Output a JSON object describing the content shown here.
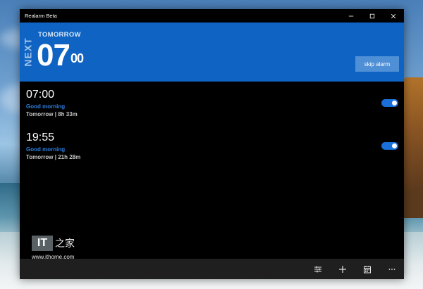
{
  "window": {
    "title": "Realarm Beta"
  },
  "banner": {
    "vertical_label": "NEXT",
    "label": "TOMORROW",
    "time_hour": "07",
    "time_minute": "00",
    "skip_label": "skip alarm"
  },
  "alarms": [
    {
      "time": "07:00",
      "name": "Good morning",
      "info": "Tomorrow | 8h 33m",
      "enabled": true
    },
    {
      "time": "19:55",
      "name": "Good morning",
      "info": "Tomorrow | 21h 28m",
      "enabled": true
    }
  ],
  "appbar": {
    "icons": [
      "filter-icon",
      "add-icon",
      "calendar-icon",
      "more-icon"
    ]
  },
  "watermark": {
    "logo_text": "IT",
    "logo_glyph": "之家",
    "url": "www.ithome.com"
  },
  "colors": {
    "accent": "#0f63c2",
    "toggle_on": "#1a6fd8",
    "alarm_name": "#2c7fe0"
  }
}
